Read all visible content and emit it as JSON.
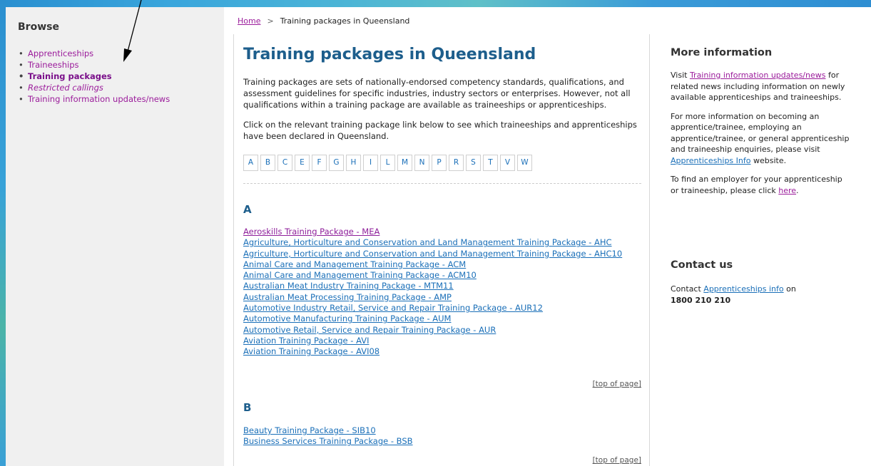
{
  "sidebar": {
    "title": "Browse",
    "items": [
      {
        "label": "Apprenticeships",
        "style": "normal"
      },
      {
        "label": "Traineeships",
        "style": "normal"
      },
      {
        "label": "Training packages",
        "style": "bold"
      },
      {
        "label": "Restricted callings",
        "style": "italic"
      },
      {
        "label": "Training information updates/news",
        "style": "normal"
      }
    ]
  },
  "breadcrumb": {
    "home": "Home",
    "separator": ">",
    "current": "Training packages in Queensland"
  },
  "main": {
    "title": "Training packages in Queensland",
    "intro": "Training packages are sets of nationally-endorsed competency standards, qualifications, and assessment guidelines for specific industries, industry sectors or enterprises. However, not all qualifications within a training package are available as traineeships or apprenticeships.",
    "intro2": "Click on the relevant training package link below to see which traineeships and apprenticeships have been declared in Queensland.",
    "letters": [
      "A",
      "B",
      "C",
      "E",
      "F",
      "G",
      "H",
      "I",
      "L",
      "M",
      "N",
      "P",
      "R",
      "S",
      "T",
      "V",
      "W"
    ],
    "sections": [
      {
        "heading": "A",
        "packages": [
          "Aeroskills Training Package - MEA",
          "Agriculture, Horticulture and Conservation and Land Management Training Package - AHC",
          "Agriculture, Horticulture and Conservation and Land Management Training Package - AHC10",
          "Animal Care and Management Training Package - ACM",
          "Animal Care and Management Training Package - ACM10",
          "Australian Meat Industry Training Package - MTM11",
          "Australian Meat Processing Training Package - AMP",
          "Automotive Industry Retail, Service and Repair Training Package - AUR12",
          "Automotive Manufacturing Training Package - AUM",
          "Automotive Retail, Service and Repair Training Package - AUR",
          "Aviation Training Package - AVI",
          "Aviation Training Package - AVI08"
        ],
        "top_link": "[top of page]"
      },
      {
        "heading": "B",
        "packages": [
          "Beauty Training Package - SIB10",
          "Business Services Training Package - BSB"
        ],
        "top_link": "[top of page]"
      }
    ]
  },
  "right": {
    "more_info_title": "More information",
    "p1_prefix": "Visit ",
    "p1_link": "Training information updates/news",
    "p1_suffix": " for related news including information on newly available apprenticeships and traineeships.",
    "p2_prefix": "For more information on becoming an apprentice/trainee, employing an apprentice/trainee, or general apprenticeship and traineeship enquiries, please visit ",
    "p2_link": "Apprenticeships Info",
    "p2_suffix": " website.",
    "p3_prefix": "To find an employer for your apprenticeship or traineeship, please click ",
    "p3_link": "here",
    "p3_suffix": ".",
    "contact_title": "Contact us",
    "contact_prefix": "Contact ",
    "contact_link": "Apprenticeships info",
    "contact_suffix": " on",
    "phone": "1800 210 210"
  },
  "colors": {
    "heading": "#1d5e8c",
    "link": "#1a6fb8",
    "visited": "#9b1c9b",
    "sidebar_bg": "#f0f0f0"
  }
}
